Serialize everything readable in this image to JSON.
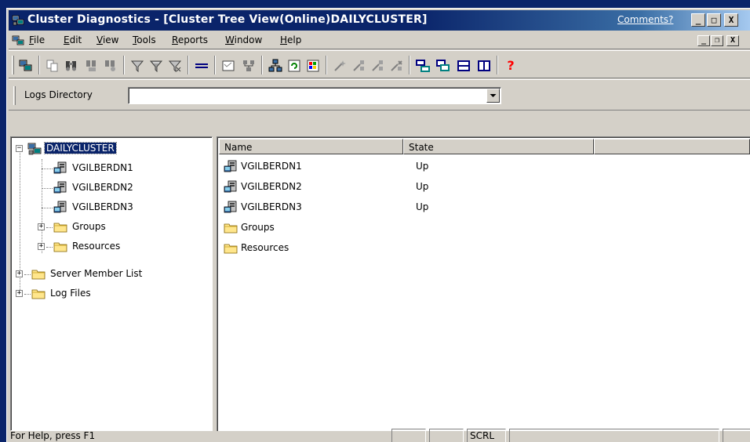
{
  "window": {
    "title": "Cluster Diagnostics - [Cluster Tree View(Online)DAILYCLUSTER]",
    "comments_link": "Comments?",
    "caption_buttons": {
      "minimize": "_",
      "maximize": "□",
      "close": "X"
    }
  },
  "menu": {
    "items": [
      {
        "label": "File",
        "accel": "F",
        "rest": "ile"
      },
      {
        "label": "Edit",
        "accel": "E",
        "rest": "dit"
      },
      {
        "label": "View",
        "accel": "V",
        "rest": "iew"
      },
      {
        "label": "Tools",
        "accel": "T",
        "rest": "ools"
      },
      {
        "label": "Reports",
        "accel": "R",
        "rest": "eports"
      },
      {
        "label": "Window",
        "accel": "W",
        "rest": "indow"
      },
      {
        "label": "Help",
        "accel": "H",
        "rest": "elp"
      }
    ],
    "mdi_buttons": {
      "minimize": "_",
      "restore": "❐",
      "close": "X"
    }
  },
  "toolbar": {
    "buttons": [
      "cluster-icon",
      "copy-icon",
      "find-icon",
      "find-node-icon",
      "find-resource-icon",
      "filter-icon",
      "filter-edit-icon",
      "filter-clear-icon",
      "separator-bar-icon",
      "properties-icon",
      "network-icon",
      "nodes-icon",
      "refresh-icon",
      "report-icon",
      "wand-icon",
      "wand-node-icon",
      "wand-group-icon",
      "wand-resource-icon",
      "tile-horizontal-icon",
      "cascade-icon",
      "split-horizontal-icon",
      "split-vertical-icon",
      "help-icon"
    ],
    "help_glyph": "?"
  },
  "logs": {
    "label": "Logs Directory",
    "value": ""
  },
  "tree": {
    "root": {
      "label": "DAILYCLUSTER",
      "expander": "−",
      "icon": "cluster-icon"
    },
    "children": [
      {
        "label": "VGILBERDN1",
        "icon": "server-node-icon"
      },
      {
        "label": "VGILBERDN2",
        "icon": "server-node-icon"
      },
      {
        "label": "VGILBERDN3",
        "icon": "server-node-icon"
      },
      {
        "label": "Groups",
        "icon": "folder-icon",
        "expander": "+"
      },
      {
        "label": "Resources",
        "icon": "folder-icon",
        "expander": "+"
      }
    ],
    "top_level": [
      {
        "label": "Server Member List",
        "icon": "folder-icon",
        "expander": "+"
      },
      {
        "label": "Log Files",
        "icon": "folder-icon",
        "expander": "+"
      }
    ]
  },
  "list": {
    "columns": [
      "Name",
      "State",
      ""
    ],
    "rows": [
      {
        "name": "VGILBERDN1",
        "state": "Up",
        "icon": "server-node-icon"
      },
      {
        "name": "VGILBERDN2",
        "state": "Up",
        "icon": "server-node-icon"
      },
      {
        "name": "VGILBERDN3",
        "state": "Up",
        "icon": "server-node-icon"
      },
      {
        "name": "Groups",
        "state": "",
        "icon": "folder-icon"
      },
      {
        "name": "Resources",
        "state": "",
        "icon": "folder-icon"
      }
    ]
  },
  "status": {
    "text": "For Help, press F1",
    "panels": [
      "",
      "",
      "SCRL",
      "",
      ""
    ]
  },
  "colors": {
    "title_bar": "#0a246a",
    "face": "#d4d0c8",
    "selection": "#0a246a",
    "folder": "#ffe68c",
    "help_red": "#ff0000"
  }
}
